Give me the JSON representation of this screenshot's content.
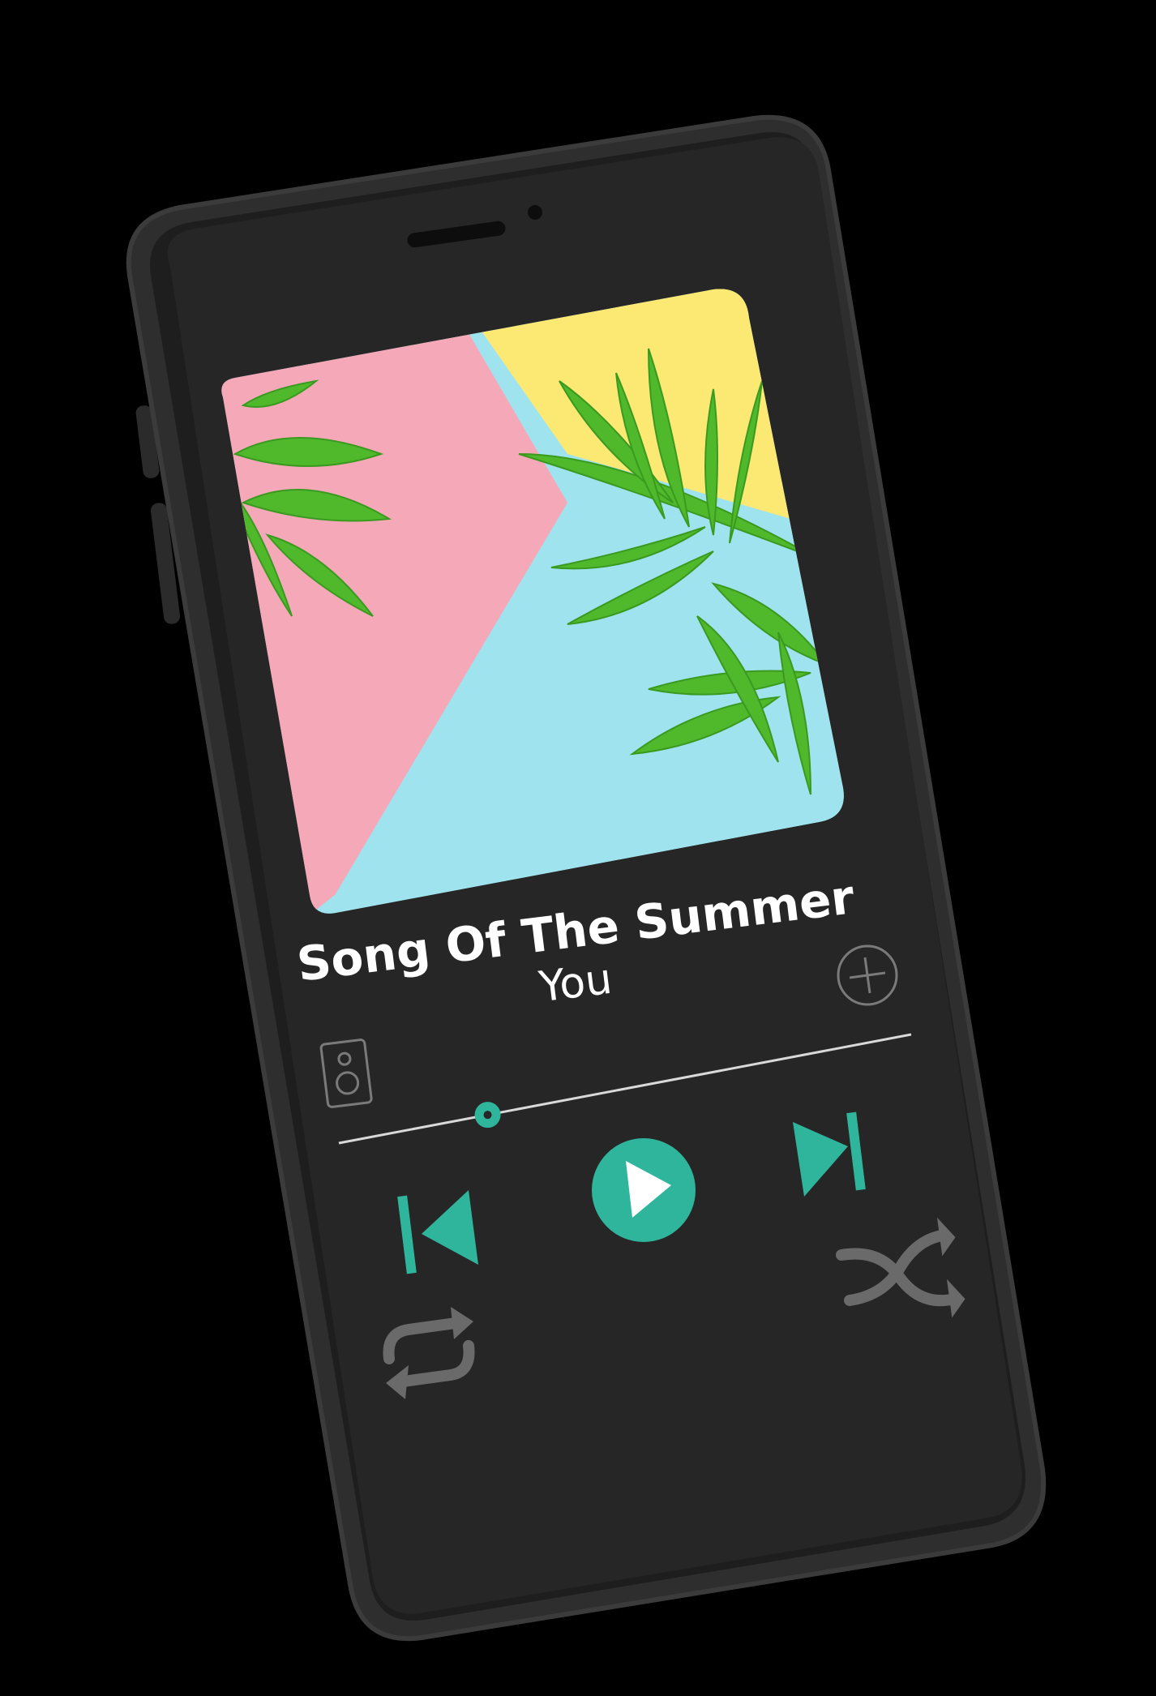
{
  "now_playing": {
    "title": "Song Of The Summer",
    "artist": "You",
    "progress": 0.26
  },
  "controls": {
    "add": "plus-icon",
    "speaker": "speaker-icon",
    "previous": "skip-previous-icon",
    "play": "play-icon",
    "next": "skip-next-icon",
    "shuffle": "shuffle-icon",
    "repeat": "repeat-icon"
  },
  "colors": {
    "accent": "#2fb59c",
    "icon_muted": "#6a6a6a",
    "screen": "#262626",
    "phone_body": "#2e2e2e",
    "text": "#ffffff",
    "art_pink": "#f5a9b8",
    "art_yellow": "#fbe974",
    "art_cyan": "#9fe3ee",
    "leaf": "#4fb82b"
  }
}
